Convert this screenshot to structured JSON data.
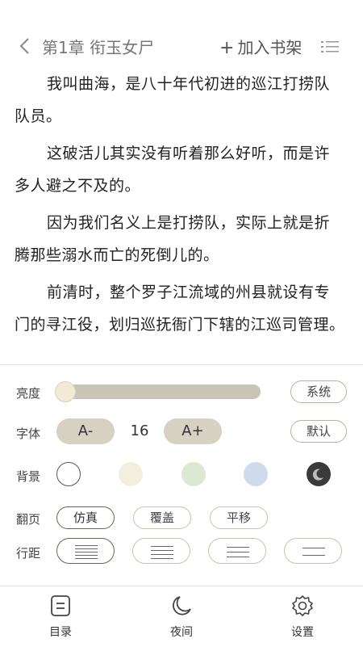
{
  "header": {
    "title": "第1章 衔玉女尸",
    "add_shelf_plus": "+",
    "add_shelf_label": "加入书架",
    "icons": {
      "back": "chevron-left-icon",
      "toc": "list-icon"
    }
  },
  "content": {
    "paragraphs": [
      "我叫曲海，是八十年代初进的巡江打捞队队员。",
      "这破活儿其实没有听着那么好听，而是许多人避之不及的。",
      "因为我们名义上是打捞队，实际上就是折腾那些溺水而亡的死倒儿的。",
      "前清时，整个罗子江流域的州县就设有专门的寻江役，划归巡抚衙门下辖的江巡司管理。"
    ]
  },
  "settings": {
    "brightness": {
      "label": "亮度",
      "level_fraction": 0.0,
      "system_label": "系统"
    },
    "font": {
      "label": "字体",
      "decrease": "A-",
      "size": "16",
      "increase": "A+",
      "default_label": "默认"
    },
    "background": {
      "label": "背景",
      "options": [
        "#ffffff",
        "#f3efde",
        "#dbe8d3",
        "#cfdbea",
        "#3a3a3a"
      ],
      "selected_index": 0
    },
    "page_turn": {
      "label": "翻页",
      "options": [
        "仿真",
        "覆盖",
        "平移"
      ],
      "selected_index": 0
    },
    "line_spacing": {
      "label": "行距",
      "options_count_lines": [
        5,
        4,
        3,
        2
      ],
      "selected_index": 0
    }
  },
  "bottom_nav": {
    "items": [
      {
        "label": "目录",
        "icon": "catalog-icon"
      },
      {
        "label": "夜间",
        "icon": "moon-icon"
      },
      {
        "label": "设置",
        "icon": "gear-icon"
      }
    ]
  },
  "colors": {
    "accent": "#d6d1c2",
    "slider_track": "#c8c4b6",
    "text": "#222222"
  }
}
